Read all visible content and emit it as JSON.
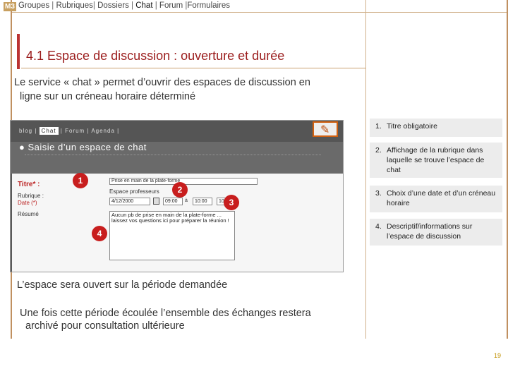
{
  "nav": {
    "badge": "M3",
    "items": [
      "Groupes",
      "Rubriques",
      "Dossiers",
      "Chat",
      "Forum",
      "Formulaires"
    ],
    "active": "Chat"
  },
  "title": "4.1 Espace de discussion : ouverture et durée",
  "intro": {
    "line1": "Le service « chat » permet d’ouvrir des espaces de discussion en",
    "line2": "ligne sur un créneau horaire déterminé"
  },
  "screenshot": {
    "tabs": [
      "blog",
      "Chat",
      "Forum",
      "Agenda"
    ],
    "heading": "● Saisie d’un espace de chat",
    "form": {
      "title_label": "Titre* :",
      "rubrique_label": "Rubrique :",
      "date_label": "Date (*)",
      "resume_label": "Résumé",
      "title_value": "Prise en main de la plate-forme",
      "espace_label": "Espace professeurs",
      "date_value": "4/12/2000",
      "time_from": "09:00",
      "a_label": "à",
      "time_mid": "10:00",
      "time_to": "10:00",
      "resume_value": "Aucun pb de prise en main de la plate-forme ... laissez vos questions ici pour préparer la réunion !"
    },
    "bubbles": [
      "1",
      "2",
      "3",
      "4"
    ]
  },
  "notes": [
    {
      "num": "1.",
      "text": "Titre obligatoire"
    },
    {
      "num": "2.",
      "text": "Affichage de la rubrique dans laquelle se trouve l’espace de chat"
    },
    {
      "num": "3.",
      "text": "Choix d’une date et d’un créneau horaire"
    },
    {
      "num": "4.",
      "text": "Descriptif/informations sur l’espace de discussion"
    }
  ],
  "after1": "L’espace sera ouvert sur la période demandée",
  "after2": {
    "line1": "Une fois cette période écoulée l’ensemble des échanges restera",
    "line2": "archivé pour consultation ultérieure"
  },
  "page_number": "19",
  "colors": {
    "accent": "#9b1c1c",
    "bubble": "#c81e1e",
    "rule": "#c09060"
  }
}
